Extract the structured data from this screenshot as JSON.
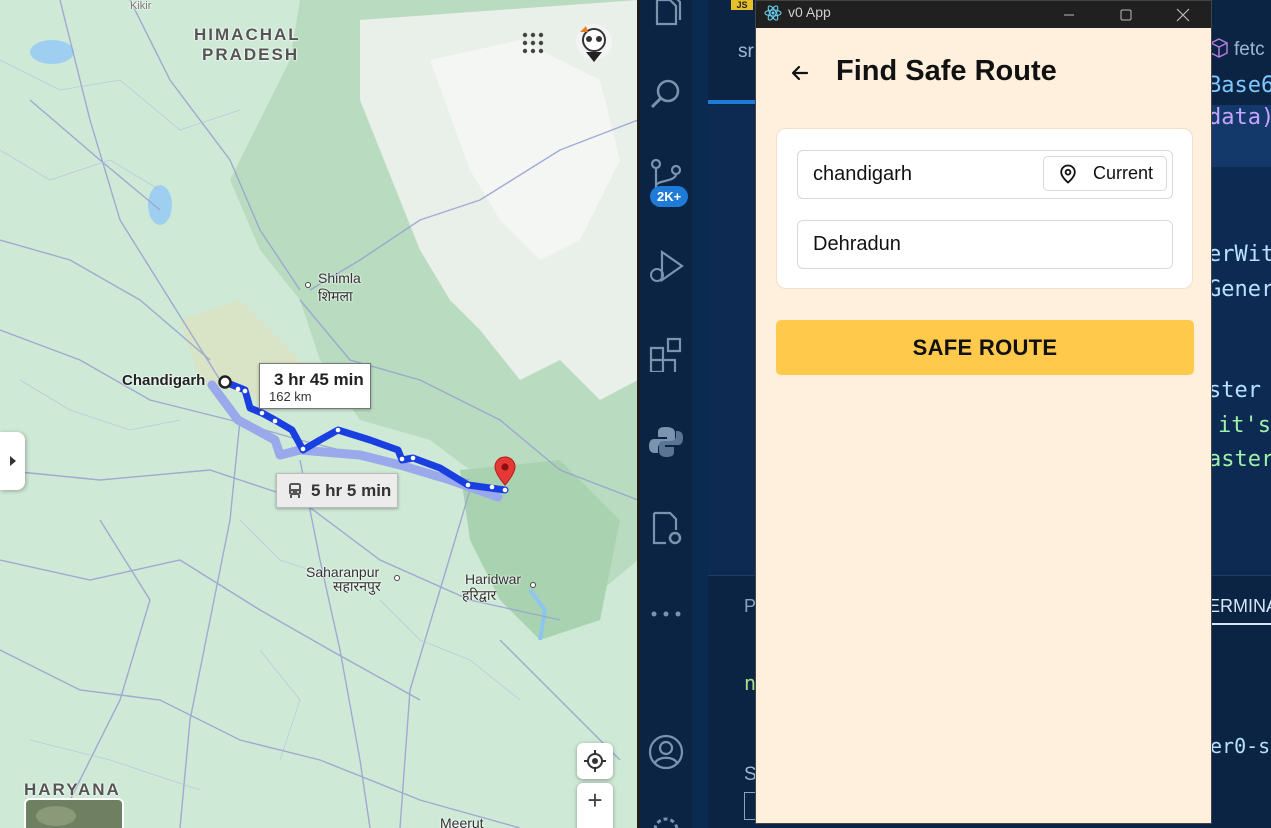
{
  "map": {
    "regions": {
      "himachal_line1": "HIMACHAL",
      "himachal_line2": "PRADESH",
      "haryana": "HARYANA"
    },
    "cities": {
      "shimla": "Shimla",
      "shimla_hi": "शिमला",
      "chandigarh": "Chandigarh",
      "saharanpur": "Saharanpur",
      "saharanpur_hi": "सहारनपुर",
      "haridwar": "Haridwar",
      "haridwar_hi": "हरिद्वार",
      "meerut": "Meerut"
    },
    "route_primary": {
      "time": "3 hr 45 min",
      "distance": "162 km"
    },
    "route_transit": {
      "time": "5 hr 5 min",
      "icon": "bus-icon"
    },
    "controls": {
      "zoom_in": "+"
    },
    "top_left_cut": "Kikir"
  },
  "vscode": {
    "badge": "2K+",
    "tab_prefix": "sr",
    "tab_right": "fetc",
    "code_lines": [
      "Base6",
      "data)",
      "erWit",
      "Gener",
      "ster",
      "it's",
      "aster"
    ],
    "panel_left": "P",
    "panel_right": "ERMINA",
    "terminal_left": "n",
    "terminal_right": "er0-s",
    "bottom_left": "S"
  },
  "app": {
    "window_title": "v0 App",
    "js_badge": "JS",
    "page_title": "Find Safe Route",
    "origin": {
      "value": "chandigarh",
      "current_label": "Current"
    },
    "destination": {
      "value": "Dehradun"
    },
    "action_label": "SAFE ROUTE",
    "accent_color": "#ffc94c",
    "background_color": "#fff0dd"
  }
}
